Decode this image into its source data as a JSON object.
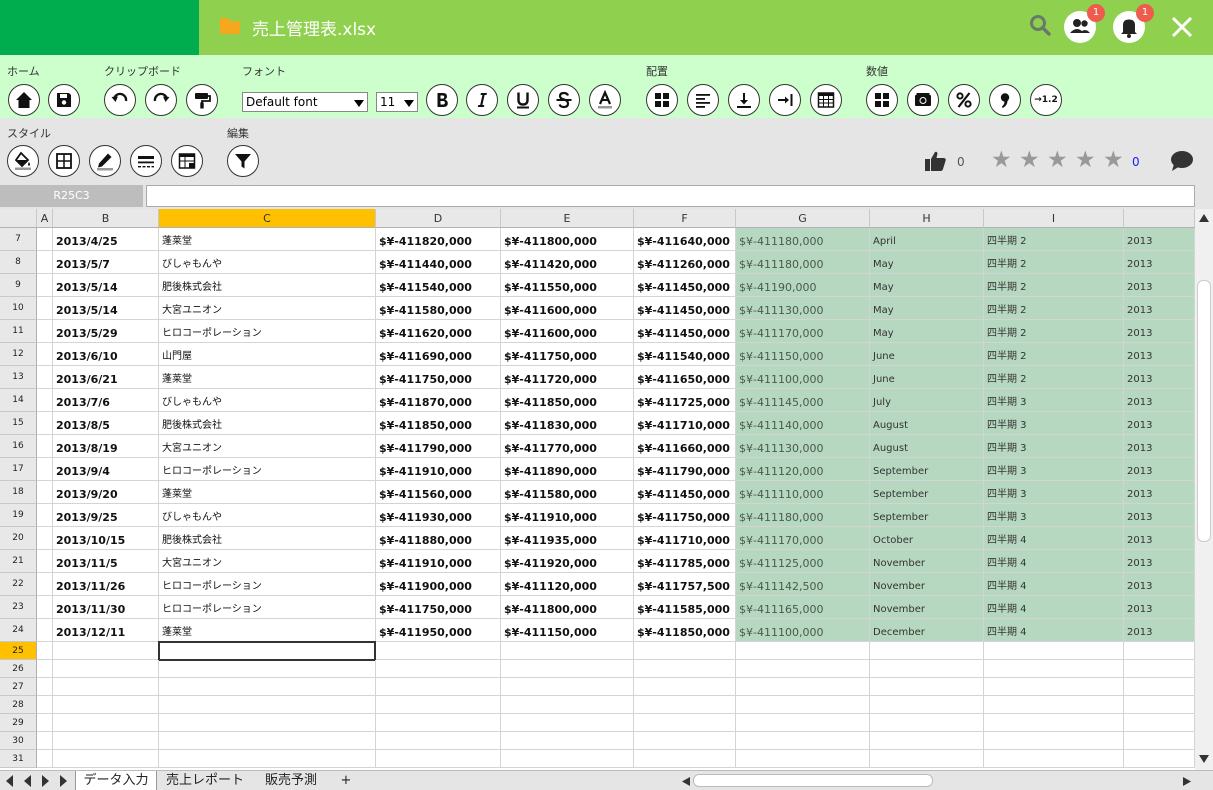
{
  "title_bar": {
    "filename": "売上管理表.xlsx",
    "badges": {
      "users": "1",
      "notifications": "1"
    }
  },
  "ribbon": {
    "groups": {
      "home": "ホーム",
      "clipboard": "クリップボード",
      "font": "フォント",
      "align": "配置",
      "number": "数値",
      "style": "スタイル",
      "edit": "編集"
    },
    "font_name": "Default font",
    "font_size": "11",
    "number_decimals": "→1.2",
    "like_count": "0",
    "star_count": "0"
  },
  "formula_bar": {
    "name_box": "R25C3",
    "formula": ""
  },
  "columns": [
    "",
    "A",
    "B",
    "C",
    "D",
    "E",
    "F",
    "G",
    "H",
    "I",
    ""
  ],
  "rows": [
    {
      "n": "7",
      "B": "2013/4/25",
      "C": "蓬莱堂",
      "D": "$¥-411820,000",
      "E": "$¥-411800,000",
      "F": "$¥-411640,000",
      "G": "$¥-411180,000",
      "H": "April",
      "I": "四半期 2",
      "J": "2013"
    },
    {
      "n": "8",
      "B": "2013/5/7",
      "C": "びしゃもんや",
      "D": "$¥-411440,000",
      "E": "$¥-411420,000",
      "F": "$¥-411260,000",
      "G": "$¥-411180,000",
      "H": "May",
      "I": "四半期 2",
      "J": "2013"
    },
    {
      "n": "9",
      "B": "2013/5/14",
      "C": "肥後株式会社",
      "D": "$¥-411540,000",
      "E": "$¥-411550,000",
      "F": "$¥-411450,000",
      "G": "$¥-41190,000",
      "H": "May",
      "I": "四半期 2",
      "J": "2013"
    },
    {
      "n": "10",
      "B": "2013/5/14",
      "C": "大宮ユニオン",
      "D": "$¥-411580,000",
      "E": "$¥-411600,000",
      "F": "$¥-411450,000",
      "G": "$¥-411130,000",
      "H": "May",
      "I": "四半期 2",
      "J": "2013"
    },
    {
      "n": "11",
      "B": "2013/5/29",
      "C": "ヒロコーポレーション",
      "D": "$¥-411620,000",
      "E": "$¥-411600,000",
      "F": "$¥-411450,000",
      "G": "$¥-411170,000",
      "H": "May",
      "I": "四半期 2",
      "J": "2013"
    },
    {
      "n": "12",
      "B": "2013/6/10",
      "C": "山門屋",
      "D": "$¥-411690,000",
      "E": "$¥-411750,000",
      "F": "$¥-411540,000",
      "G": "$¥-411150,000",
      "H": "June",
      "I": "四半期 2",
      "J": "2013"
    },
    {
      "n": "13",
      "B": "2013/6/21",
      "C": "蓬莱堂",
      "D": "$¥-411750,000",
      "E": "$¥-411720,000",
      "F": "$¥-411650,000",
      "G": "$¥-411100,000",
      "H": "June",
      "I": "四半期 2",
      "J": "2013"
    },
    {
      "n": "14",
      "B": "2013/7/6",
      "C": "びしゃもんや",
      "D": "$¥-411870,000",
      "E": "$¥-411850,000",
      "F": "$¥-411725,000",
      "G": "$¥-411145,000",
      "H": "July",
      "I": "四半期 3",
      "J": "2013"
    },
    {
      "n": "15",
      "B": "2013/8/5",
      "C": "肥後株式会社",
      "D": "$¥-411850,000",
      "E": "$¥-411830,000",
      "F": "$¥-411710,000",
      "G": "$¥-411140,000",
      "H": "August",
      "I": "四半期 3",
      "J": "2013"
    },
    {
      "n": "16",
      "B": "2013/8/19",
      "C": "大宮ユニオン",
      "D": "$¥-411790,000",
      "E": "$¥-411770,000",
      "F": "$¥-411660,000",
      "G": "$¥-411130,000",
      "H": "August",
      "I": "四半期 3",
      "J": "2013"
    },
    {
      "n": "17",
      "B": "2013/9/4",
      "C": "ヒロコーポレーション",
      "D": "$¥-411910,000",
      "E": "$¥-411890,000",
      "F": "$¥-411790,000",
      "G": "$¥-411120,000",
      "H": "September",
      "I": "四半期 3",
      "J": "2013"
    },
    {
      "n": "18",
      "B": "2013/9/20",
      "C": "蓬莱堂",
      "D": "$¥-411560,000",
      "E": "$¥-411580,000",
      "F": "$¥-411450,000",
      "G": "$¥-411110,000",
      "H": "September",
      "I": "四半期 3",
      "J": "2013"
    },
    {
      "n": "19",
      "B": "2013/9/25",
      "C": "びしゃもんや",
      "D": "$¥-411930,000",
      "E": "$¥-411910,000",
      "F": "$¥-411750,000",
      "G": "$¥-411180,000",
      "H": "September",
      "I": "四半期 3",
      "J": "2013"
    },
    {
      "n": "20",
      "B": "2013/10/15",
      "C": "肥後株式会社",
      "D": "$¥-411880,000",
      "E": "$¥-411935,000",
      "F": "$¥-411710,000",
      "G": "$¥-411170,000",
      "H": "October",
      "I": "四半期 4",
      "J": "2013"
    },
    {
      "n": "21",
      "B": "2013/11/5",
      "C": "大宮ユニオン",
      "D": "$¥-411910,000",
      "E": "$¥-411920,000",
      "F": "$¥-411785,000",
      "G": "$¥-411125,000",
      "H": "November",
      "I": "四半期 4",
      "J": "2013"
    },
    {
      "n": "22",
      "B": "2013/11/26",
      "C": "ヒロコーポレーション",
      "D": "$¥-411900,000",
      "E": "$¥-411120,000",
      "F": "$¥-411757,500",
      "G": "$¥-411142,500",
      "H": "November",
      "I": "四半期 4",
      "J": "2013"
    },
    {
      "n": "23",
      "B": "2013/11/30",
      "C": "ヒロコーポレーション",
      "D": "$¥-411750,000",
      "E": "$¥-411800,000",
      "F": "$¥-411585,000",
      "G": "$¥-411165,000",
      "H": "November",
      "I": "四半期 4",
      "J": "2013"
    },
    {
      "n": "24",
      "B": "2013/12/11",
      "C": "蓬莱堂",
      "D": "$¥-411950,000",
      "E": "$¥-411150,000",
      "F": "$¥-411850,000",
      "G": "$¥-411100,000",
      "H": "December",
      "I": "四半期 4",
      "J": "2013"
    }
  ],
  "empty_rows": [
    "25",
    "26",
    "27",
    "28",
    "29",
    "30",
    "31"
  ],
  "selected_row": "25",
  "selected_column": "C",
  "sheet_tabs": [
    "データ入力",
    "売上レポート",
    "販売予測"
  ],
  "add_sheet": "+",
  "colors": {
    "title_bar": "#8fd14f",
    "brand": "#00ad4e",
    "ribbon": "#ccffcc",
    "highlight_fill": "#b7d8c0",
    "selection": "#ffc000",
    "badge": "#ef5b4c"
  }
}
